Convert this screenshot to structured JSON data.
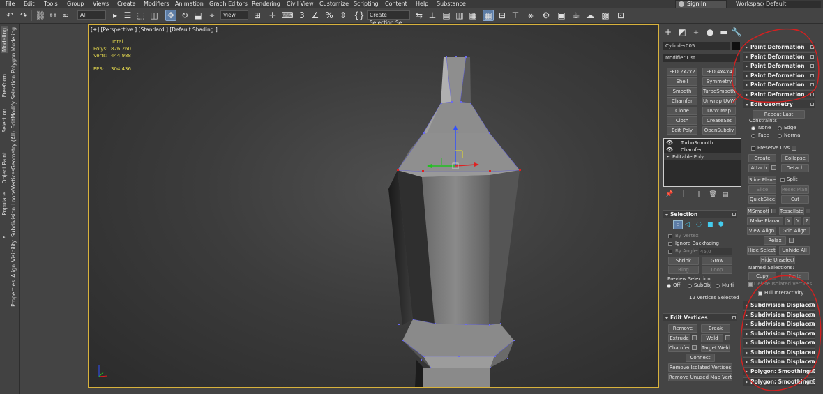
{
  "menubar": {
    "items": [
      "File",
      "Edit",
      "Tools",
      "Group",
      "Views",
      "Create",
      "Modifiers",
      "Animation",
      "Graph Editors",
      "Rendering",
      "Civil View",
      "Customize",
      "Scripting",
      "Content",
      "Help",
      "Substance"
    ],
    "sign_in": "Sign In",
    "workspaces_label": "Workspaces:",
    "workspaces_value": "Default"
  },
  "toolbar": {
    "selection_filter": "All",
    "ref_coord": "View",
    "named_selection_set": "Create Selection Se"
  },
  "ribbon": {
    "tabs": [
      "Modeling",
      "Freeform",
      "Selection",
      "Object Paint",
      "Populate"
    ],
    "sub": [
      "Polygon Modeling",
      "Modify Selection",
      "Edit",
      "Geometry (All)",
      "Vertices",
      "Loops",
      "Subdivision",
      "Visibility",
      "Align",
      "Properties"
    ]
  },
  "viewport": {
    "label": "[+] [Perspective ] [Standard ] [Default Shading ]",
    "stats": {
      "total_label": "Total",
      "polys_label": "Polys:",
      "polys_value": "826 260",
      "verts_label": "Verts:",
      "verts_value": "444 988",
      "fps_label": "FPS:",
      "fps_value": "304,436"
    }
  },
  "command_panel": {
    "object_name": "Cylinder005",
    "modifier_list": "Modifier List",
    "modifier_buttons": [
      "FFD 2x2x2",
      "FFD 4x4x4",
      "Shell",
      "Symmetry",
      "Smooth",
      "TurboSmooth",
      "Chamfer",
      "Unwrap UVW",
      "Clone",
      "UVW Map",
      "Cloth",
      "CreaseSet",
      "Edit Poly",
      "OpenSubdiv"
    ],
    "stack": [
      "TurboSmooth",
      "Chamfer",
      "Editable Poly"
    ],
    "selection": {
      "title": "Selection",
      "by_vertex": "By Vertex",
      "ignore_backfacing": "Ignore Backfacing",
      "by_angle": "By Angle:",
      "angle_value": "45,0",
      "shrink": "Shrink",
      "grow": "Grow",
      "ring": "Ring",
      "loop": "Loop",
      "preview_selection": "Preview Selection",
      "off": "Off",
      "subobj": "SubObj",
      "multi": "Multi",
      "status": "12 Vertices Selected"
    },
    "edit_vertices": {
      "title": "Edit Vertices",
      "remove": "Remove",
      "break": "Break",
      "extrude": "Extrude",
      "weld": "Weld",
      "chamfer": "Chamfer",
      "target_weld": "Target Weld",
      "connect": "Connect",
      "remove_isolated": "Remove Isolated Vertices",
      "remove_unused": "Remove Unused Map Verts"
    }
  },
  "right_panel": {
    "paint_deformation": [
      "Paint Deformation",
      "Paint Deformation",
      "Paint Deformation",
      "Paint Deformation",
      "Paint Deformation",
      "Paint Deformation"
    ],
    "edit_geometry": {
      "title": "Edit Geometry",
      "repeat_last": "Repeat Last",
      "constraints": "Constraints",
      "none": "None",
      "edge": "Edge",
      "face": "Face",
      "normal": "Normal",
      "preserve_uvs": "Preserve UVs",
      "create": "Create",
      "collapse": "Collapse",
      "attach": "Attach",
      "detach": "Detach",
      "slice_plane": "Slice Plane",
      "split": "Split",
      "slice": "Slice",
      "reset_plane": "Reset Plane",
      "quickslice": "QuickSlice",
      "cut": "Cut",
      "msmooth": "MSmooth",
      "tessellate": "Tessellate",
      "make_planar": "Make Planar",
      "x": "X",
      "y": "Y",
      "z": "Z",
      "view_align": "View Align",
      "grid_align": "Grid Align",
      "relax": "Relax",
      "hide_selected": "Hide Selected",
      "unhide_all": "Unhide All",
      "hide_unselected": "Hide Unselected",
      "named_selections": "Named Selections:",
      "copy": "Copy",
      "paste": "Paste",
      "delete_isolated": "Delete Isolated Vertices",
      "full_interactivity": "Full Interactivity"
    },
    "subdivision": [
      "Subdivision Displacemen",
      "Subdivision Displacemen",
      "Subdivision Displacemen",
      "Subdivision Displacemen",
      "Subdivision Displacemen",
      "Subdivision Displacemen",
      "Subdivision Displacemen"
    ],
    "polygon_smoothing": [
      "Polygon: Smoothing Gro",
      "Polygon: Smoothing Gro"
    ]
  },
  "colors": {
    "viewport_border": "#d8b23c",
    "selected_vertex": "#e02020",
    "vertex": "#6060e0",
    "annotation": "#d42020",
    "accent": "#5d7da6"
  }
}
